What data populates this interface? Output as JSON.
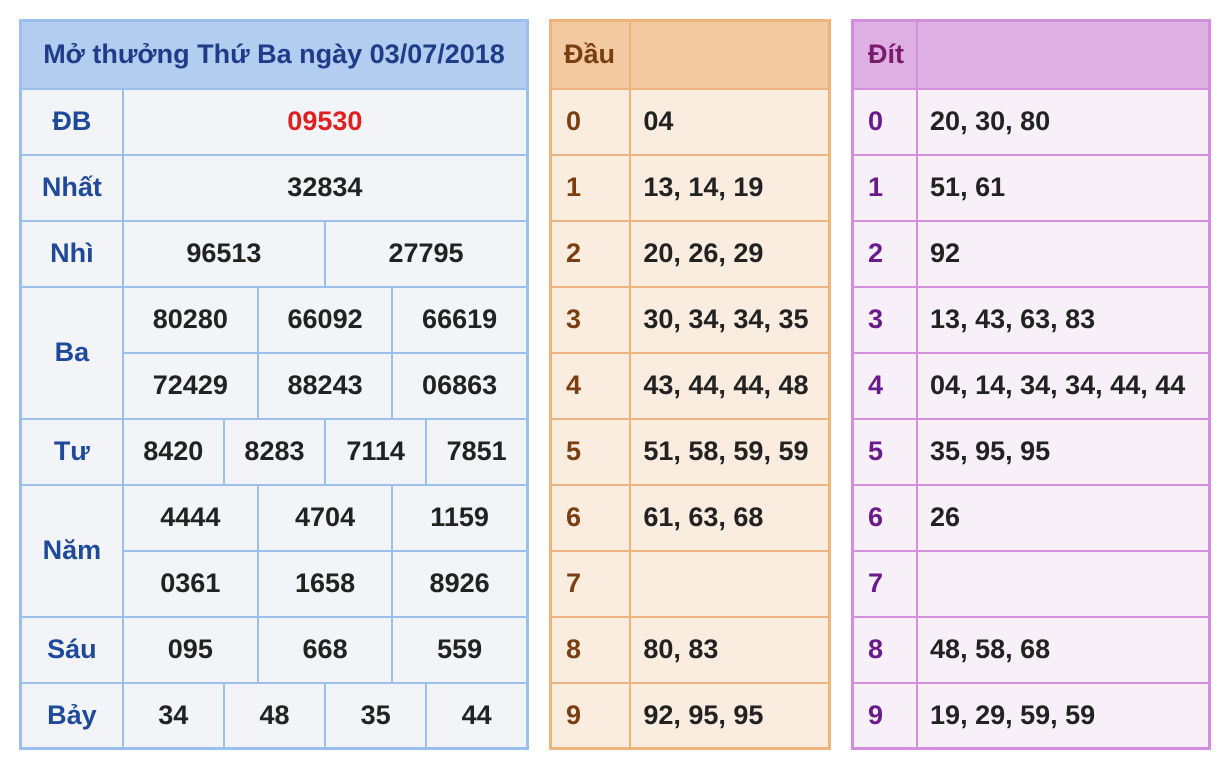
{
  "results": {
    "title": "Mở thưởng Thứ Ba ngày 03/07/2018",
    "rows": [
      {
        "label": "ĐB",
        "values": [
          [
            "09530"
          ]
        ]
      },
      {
        "label": "Nhất",
        "values": [
          [
            "32834"
          ]
        ]
      },
      {
        "label": "Nhì",
        "values": [
          [
            "96513",
            "27795"
          ]
        ]
      },
      {
        "label": "Ba",
        "values": [
          [
            "80280",
            "66092",
            "66619"
          ],
          [
            "72429",
            "88243",
            "06863"
          ]
        ]
      },
      {
        "label": "Tư",
        "values": [
          [
            "8420",
            "8283",
            "7114",
            "7851"
          ]
        ]
      },
      {
        "label": "Năm",
        "values": [
          [
            "4444",
            "4704",
            "1159"
          ],
          [
            "0361",
            "1658",
            "8926"
          ]
        ]
      },
      {
        "label": "Sáu",
        "values": [
          [
            "095",
            "668",
            "559"
          ]
        ]
      },
      {
        "label": "Bảy",
        "values": [
          [
            "34",
            "48",
            "35",
            "44"
          ]
        ]
      }
    ]
  },
  "dau": {
    "header": "Đầu",
    "rows": [
      {
        "key": "0",
        "value": "04"
      },
      {
        "key": "1",
        "value": "13, 14, 19"
      },
      {
        "key": "2",
        "value": "20, 26, 29"
      },
      {
        "key": "3",
        "value": "30, 34, 34, 35"
      },
      {
        "key": "4",
        "value": "43, 44, 44, 48"
      },
      {
        "key": "5",
        "value": "51, 58, 59, 59"
      },
      {
        "key": "6",
        "value": "61, 63, 68"
      },
      {
        "key": "7",
        "value": ""
      },
      {
        "key": "8",
        "value": "80, 83"
      },
      {
        "key": "9",
        "value": "92, 95, 95"
      }
    ]
  },
  "dit": {
    "header": "Đít",
    "rows": [
      {
        "key": "0",
        "value": "20, 30, 80"
      },
      {
        "key": "1",
        "value": "51, 61"
      },
      {
        "key": "2",
        "value": "92"
      },
      {
        "key": "3",
        "value": "13, 43, 63, 83"
      },
      {
        "key": "4",
        "value": "04, 14, 34, 34, 44, 44"
      },
      {
        "key": "5",
        "value": "35, 95, 95"
      },
      {
        "key": "6",
        "value": "26"
      },
      {
        "key": "7",
        "value": ""
      },
      {
        "key": "8",
        "value": "48, 58, 68"
      },
      {
        "key": "9",
        "value": "19, 29, 59, 59"
      }
    ]
  },
  "colors": {
    "special_prize": "#e02020",
    "results_border": "#9bbfef",
    "dau_border": "#edb57d",
    "dit_border": "#d48fdc"
  }
}
